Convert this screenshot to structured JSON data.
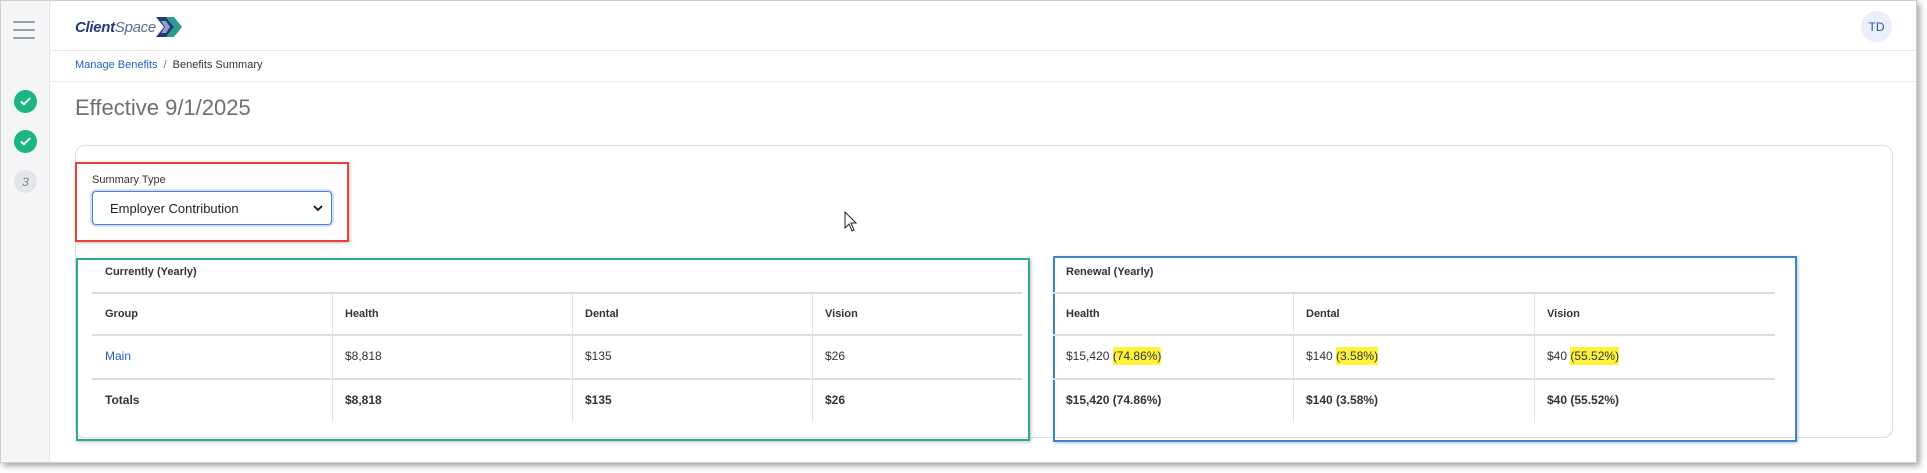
{
  "app": {
    "logo_text_bold": "Client",
    "logo_text_light": "Space",
    "avatar_initials": "TD"
  },
  "steps": [
    {
      "status": "done",
      "icon": "check-icon"
    },
    {
      "status": "done",
      "icon": "check-icon"
    },
    {
      "status": "pending",
      "label": "3"
    }
  ],
  "breadcrumb": {
    "parent": "Manage Benefits",
    "separator": "/",
    "current": "Benefits Summary"
  },
  "page_title": "Effective 9/1/2025",
  "summary_type": {
    "label": "Summary Type",
    "selected": "Employer Contribution"
  },
  "current_table": {
    "caption": "Currently (Yearly)",
    "headers": [
      "Group",
      "Health",
      "Dental",
      "Vision"
    ],
    "rows": [
      {
        "group": "Main",
        "health": "$8,818",
        "dental": "$135",
        "vision": "$26"
      }
    ],
    "totals": {
      "label": "Totals",
      "health": "$8,818",
      "dental": "$135",
      "vision": "$26"
    }
  },
  "renewal_table": {
    "caption": "Renewal (Yearly)",
    "headers": [
      "Health",
      "Dental",
      "Vision"
    ],
    "rows": [
      {
        "health_amount": "$15,420",
        "health_pct": "(74.86%)",
        "dental_amount": "$140",
        "dental_pct": "(3.58%)",
        "vision_amount": "$40",
        "vision_pct": "(55.52%)"
      }
    ],
    "totals": {
      "health": "$15,420 (74.86%)",
      "dental": "$140 (3.58%)",
      "vision": "$40 (55.52%)"
    }
  },
  "colors": {
    "accent_blue": "#1f62c5",
    "step_done": "#1db584",
    "highlight_red": "#e8403d",
    "highlight_green": "#2fae76",
    "highlight_blue": "#3b83c4",
    "marker_yellow": "#fff23a"
  }
}
